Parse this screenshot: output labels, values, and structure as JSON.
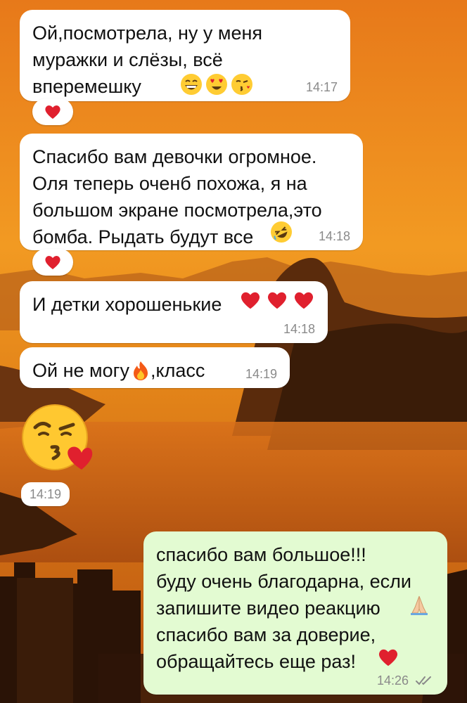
{
  "colors": {
    "incoming_bubble": "#ffffff",
    "outgoing_bubble": "#e3fbd2",
    "timestamp": "#8a8a8a",
    "heart": "#e0202e",
    "wallpaper_sky": "#f0951e",
    "wallpaper_mountains": "#3a1e0a"
  },
  "messages": [
    {
      "text": "Ой,посмотрела, ну у меня\nмуражки и слёзы, всё\nвперемешку",
      "emojis": [
        "grinning-face",
        "heart-eyes-face",
        "kissing-heart-face"
      ],
      "time": "14:17",
      "reaction": "red-heart"
    },
    {
      "text": "Спасибо вам девочки огромное.\nОля теперь оченб похожа, я на\nбольшом экране посмотрела,это\nбомба. Рыдать будут все",
      "emojis": [
        "rolling-laughing-face"
      ],
      "time": "14:18",
      "reaction": "red-heart"
    },
    {
      "text": "И детки хорошенькие",
      "emojis": [
        "red-heart",
        "red-heart",
        "red-heart"
      ],
      "time": "14:18"
    },
    {
      "text_before": "Ой не могу",
      "emoji": "fire",
      "text_after": ",класс",
      "time": "14:19"
    },
    {
      "sticker": "face-blowing-kiss",
      "time": "14:19"
    },
    {
      "text": "спасибо вам большое!!!\nбуду очень благодарна, если\nзапишите видео реакцию",
      "emoji_mid": "folded-hands",
      "text2": "спасибо вам за доверие,\nобращайтесь еще раз!",
      "emoji_end": "red-heart",
      "time": "14:26",
      "status_icon": "double-check-icon"
    }
  ]
}
